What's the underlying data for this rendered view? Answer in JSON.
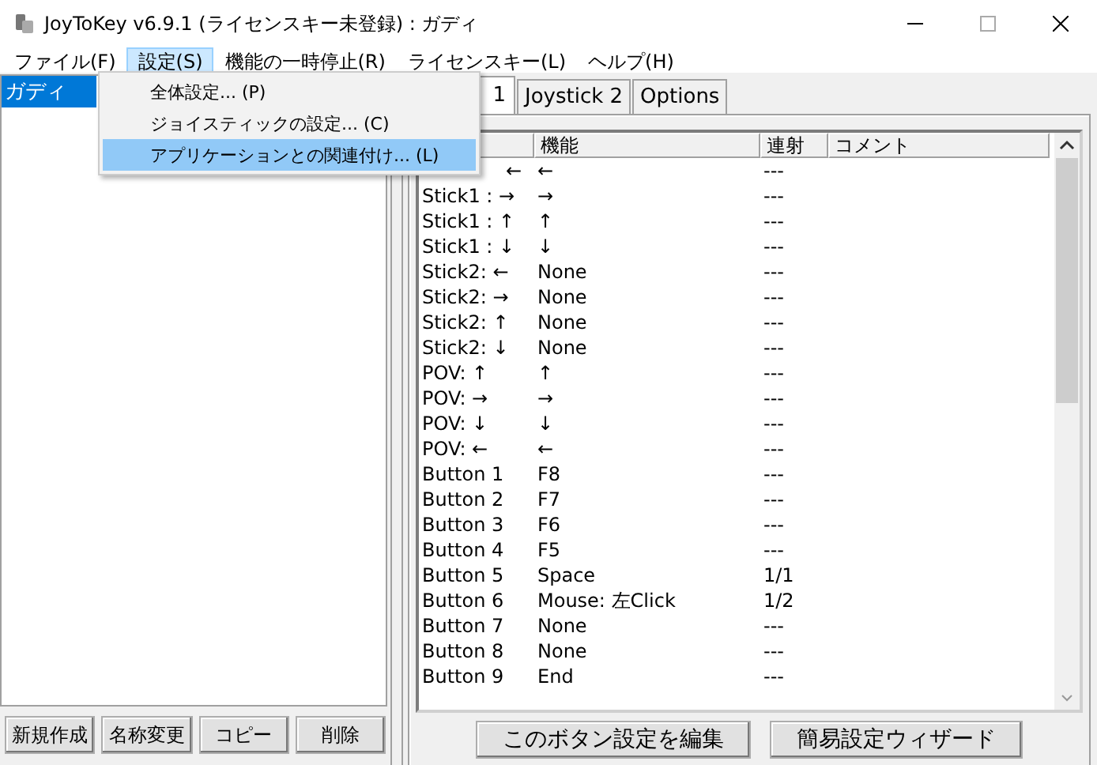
{
  "window": {
    "title": "JoyToKey v6.9.1 (ライセンスキー未登録) : ガディ"
  },
  "menu_bar": [
    {
      "label": "ファイル(F)",
      "selected": false
    },
    {
      "label": "設定(S)",
      "selected": true
    },
    {
      "label": "機能の一時停止(R)",
      "selected": false
    },
    {
      "label": "ライセンスキー(L)",
      "selected": false
    },
    {
      "label": "ヘルプ(H)",
      "selected": false
    }
  ],
  "dropdown": [
    {
      "label": "全体設定... (P)",
      "selected": false
    },
    {
      "label": "ジョイスティックの設定... (C)",
      "selected": false
    },
    {
      "label": "アプリケーションとの関連付け... (L)",
      "selected": true
    }
  ],
  "profiles": [
    {
      "label": "ガディ",
      "selected": true
    }
  ],
  "profile_buttons": [
    "新規作成",
    "名称変更",
    "コピー",
    "削除"
  ],
  "tabs": [
    {
      "label": "1",
      "selected": true
    },
    {
      "label": "Joystick 2",
      "selected": false
    },
    {
      "label": "Options",
      "selected": false
    }
  ],
  "table": {
    "columns": [
      "機能",
      "連射",
      "コメント"
    ],
    "rows": [
      {
        "input": "←",
        "clipped": true,
        "function": "←",
        "turbo": "---"
      },
      {
        "input": "Stick1 : →",
        "clipped": false,
        "function": "→",
        "turbo": "---"
      },
      {
        "input": "Stick1 : ↑",
        "clipped": false,
        "function": "↑",
        "turbo": "---"
      },
      {
        "input": "Stick1 : ↓",
        "clipped": false,
        "function": "↓",
        "turbo": "---"
      },
      {
        "input": "Stick2: ←",
        "clipped": false,
        "function": "None",
        "turbo": "---"
      },
      {
        "input": "Stick2: →",
        "clipped": false,
        "function": "None",
        "turbo": "---"
      },
      {
        "input": "Stick2: ↑",
        "clipped": false,
        "function": "None",
        "turbo": "---"
      },
      {
        "input": "Stick2: ↓",
        "clipped": false,
        "function": "None",
        "turbo": "---"
      },
      {
        "input": "POV: ↑",
        "clipped": false,
        "function": "↑",
        "turbo": "---"
      },
      {
        "input": "POV: →",
        "clipped": false,
        "function": "→",
        "turbo": "---"
      },
      {
        "input": "POV: ↓",
        "clipped": false,
        "function": "↓",
        "turbo": "---"
      },
      {
        "input": "POV: ←",
        "clipped": false,
        "function": "←",
        "turbo": "---"
      },
      {
        "input": "Button 1",
        "clipped": false,
        "function": "F8",
        "turbo": "---"
      },
      {
        "input": "Button 2",
        "clipped": false,
        "function": "F7",
        "turbo": "---"
      },
      {
        "input": "Button 3",
        "clipped": false,
        "function": "F6",
        "turbo": "---"
      },
      {
        "input": "Button 4",
        "clipped": false,
        "function": "F5",
        "turbo": "---"
      },
      {
        "input": "Button 5",
        "clipped": false,
        "function": "Space",
        "turbo": "1/1"
      },
      {
        "input": "Button 6",
        "clipped": false,
        "function": "Mouse: 左Click",
        "turbo": "1/2"
      },
      {
        "input": "Button 7",
        "clipped": false,
        "function": "None",
        "turbo": "---"
      },
      {
        "input": "Button 8",
        "clipped": false,
        "function": "None",
        "turbo": "---"
      },
      {
        "input": "Button 9",
        "clipped": false,
        "function": "End",
        "turbo": "---"
      }
    ]
  },
  "action_buttons": [
    "このボタン設定を編集",
    "簡易設定ウィザード"
  ]
}
